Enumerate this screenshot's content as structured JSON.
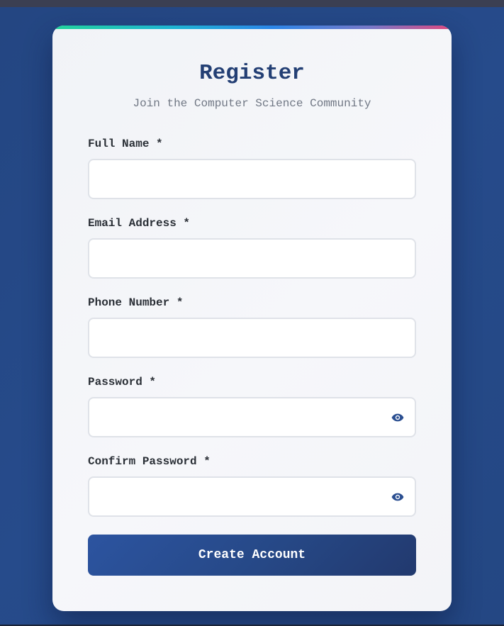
{
  "form": {
    "title": "Register",
    "subtitle": "Join the Computer Science Community",
    "fields": [
      {
        "label": "Full Name *",
        "value": "",
        "placeholder": "",
        "type": "text"
      },
      {
        "label": "Email Address *",
        "value": "",
        "placeholder": "",
        "type": "email"
      },
      {
        "label": "Phone Number *",
        "value": "",
        "placeholder": "",
        "type": "tel"
      },
      {
        "label": "Password *",
        "value": "",
        "placeholder": "",
        "type": "password",
        "icon": "eye-icon"
      },
      {
        "label": "Confirm Password *",
        "value": "",
        "placeholder": "",
        "type": "password",
        "icon": "eye-icon"
      }
    ],
    "submit_label": "Create Account"
  },
  "colors": {
    "background": "#254a88",
    "card": "#f3f4f8",
    "title": "#233f74",
    "subtitle": "#707784",
    "label": "#2a2f36",
    "input_border": "#dfe2e8",
    "eye_icon": "#2b4f91",
    "button": "#264886",
    "accent_gradient": [
      "#22d39b",
      "#1fb5d2",
      "#2b86e8",
      "#7a78c7",
      "#e0487f"
    ]
  }
}
